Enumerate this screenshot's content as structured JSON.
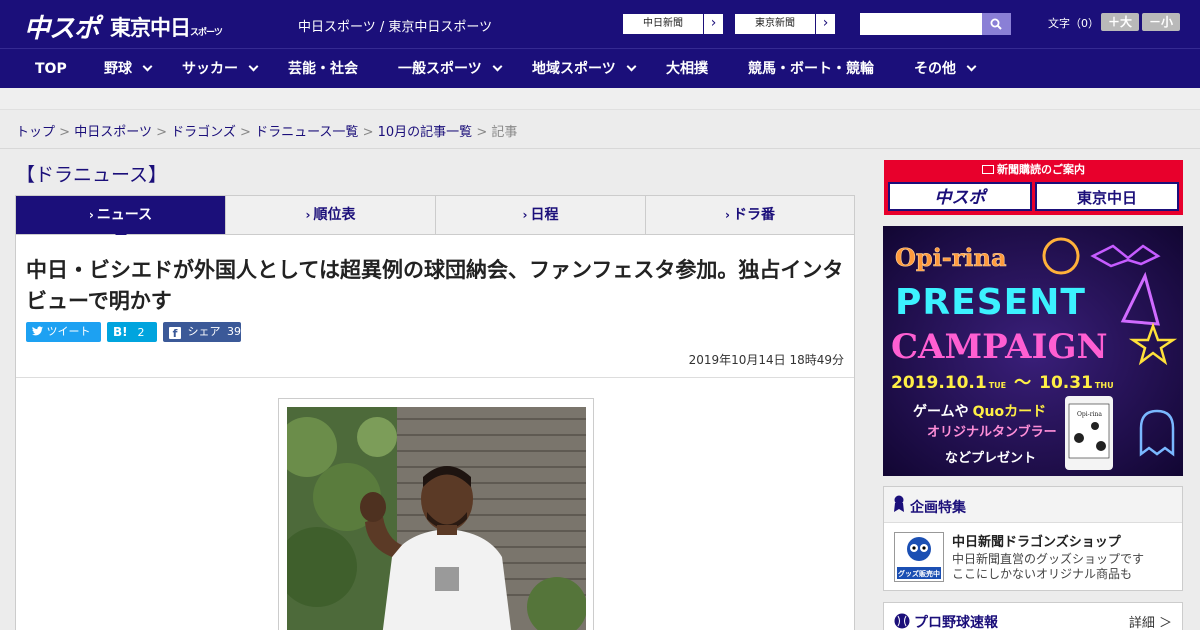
{
  "header": {
    "logo_chuspo": "中スポ",
    "logo_tokyo": "東京中日",
    "logo_tokyo_sub": "スポーツ",
    "tagline": "中日スポーツ / 東京中日スポーツ",
    "link_chunichi": "中日新聞",
    "link_tokyo": "東京新聞",
    "search_placeholder": "",
    "font_size_label": "文字（0）",
    "font_bigger": "＋大",
    "font_smaller": "－小"
  },
  "nav": {
    "items": [
      {
        "label": "TOP"
      },
      {
        "label": "野球"
      },
      {
        "label": "サッカー"
      },
      {
        "label": "芸能・社会"
      },
      {
        "label": "一般スポーツ"
      },
      {
        "label": "地域スポーツ"
      },
      {
        "label": "大相撲"
      },
      {
        "label": "競馬・ボート・競輪"
      },
      {
        "label": "その他"
      }
    ]
  },
  "breadcrumb": {
    "items": [
      "トップ",
      "中日スポーツ",
      "ドラゴンズ",
      "ドラニュース一覧",
      "10月の記事一覧"
    ],
    "current": "記事",
    "separator": ">"
  },
  "section_title": "【ドラニュース】",
  "tabs": [
    {
      "label": "ニュース",
      "active": true
    },
    {
      "label": "順位表",
      "active": false
    },
    {
      "label": "日程",
      "active": false
    },
    {
      "label": "ドラ番",
      "active": false
    }
  ],
  "article": {
    "headline": "中日・ビシエドが外国人としては超異例の球団納会、ファンフェスタ参加。独占インタビューで明かす",
    "share_tweet": "ツイート",
    "share_hatena_icon": "B!",
    "share_hatena_count": "2",
    "share_fb": "シェア",
    "share_fb_count": "39",
    "date": "2019年10月14日 18時49分"
  },
  "sidebar": {
    "subscribe_title": "新聞購読のご案内",
    "subscribe_logo1": "中スポ",
    "subscribe_logo2": "東京中日",
    "ad": {
      "brand": "Opi-rina",
      "line1": "PRESENT",
      "line2": "CAMPAIGN",
      "period": "2019.10.1",
      "period_day1": "TUE",
      "period_sep": "〜",
      "period_end": "10.31",
      "period_day2": "THU",
      "prize1": "ゲームや",
      "prize1b": "Quoカード",
      "prize2": "オリジナルタンブラー",
      "prize3": "などプレゼント",
      "tumbler_label": "Opi-rina"
    },
    "feature": {
      "title": "企画特集",
      "item_title": "中日新聞ドラゴンズショップ",
      "item_desc1": "中日新聞直営のグッズショップです",
      "item_desc2": "ここにしかないオリジナル商品も",
      "thumb_label": "グッズ販売中"
    },
    "sokuho": {
      "title": "プロ野球速報",
      "detail": "詳細 ＞"
    }
  },
  "colors": {
    "brand_navy": "#1b0f7a",
    "twitter": "#1da1f2",
    "hatena": "#00a4de",
    "facebook": "#3b5998",
    "subscribe_red": "#e8002c"
  }
}
